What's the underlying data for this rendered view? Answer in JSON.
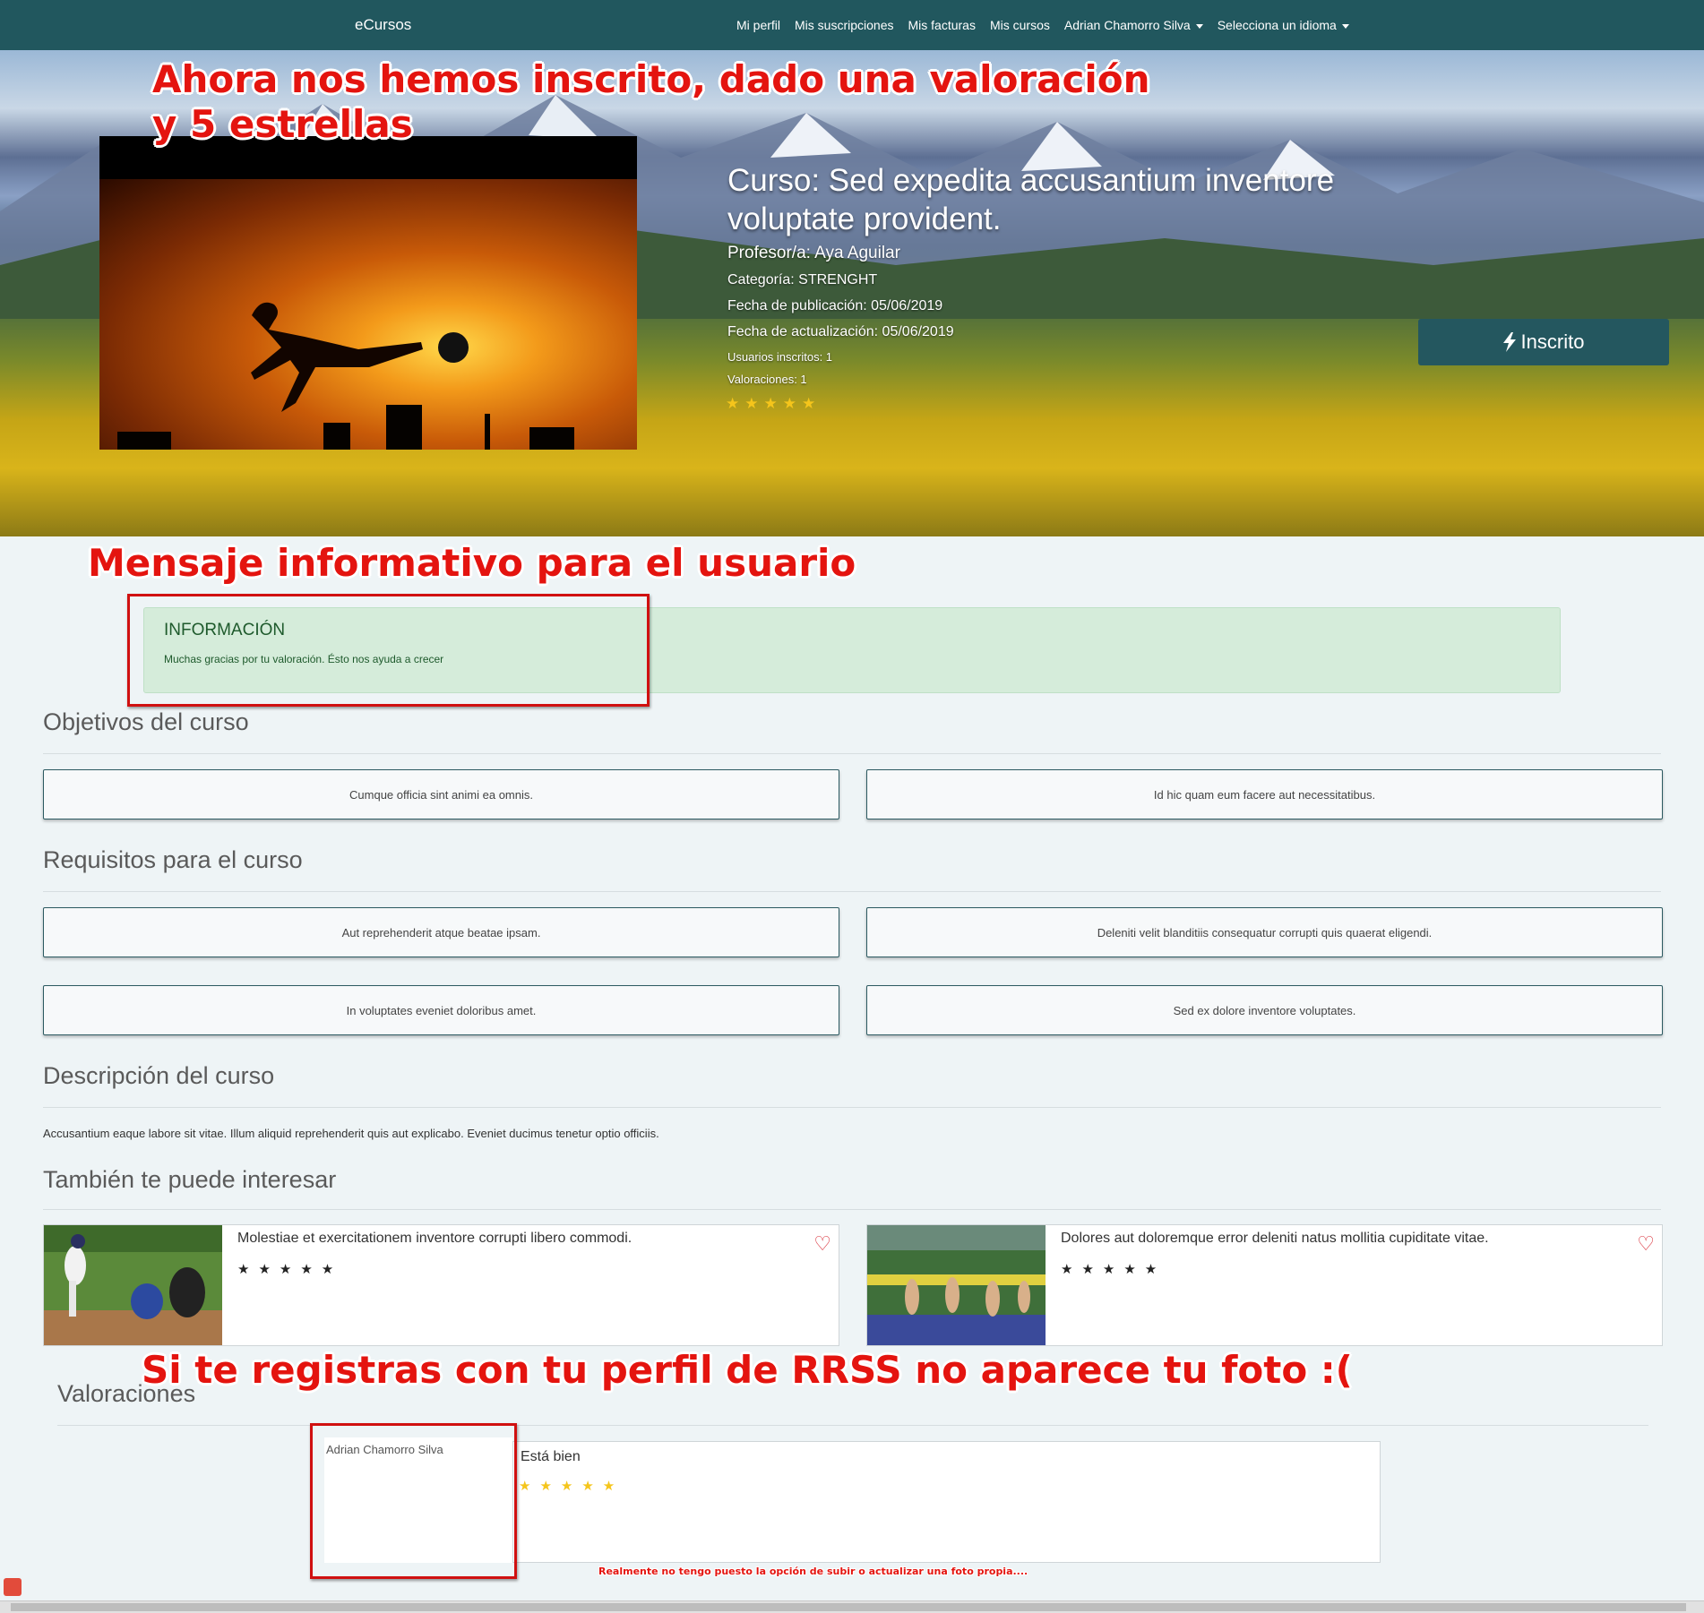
{
  "navbar": {
    "brand": "eCursos",
    "items": [
      "Mi perfil",
      "Mis suscripciones",
      "Mis facturas",
      "Mis cursos"
    ],
    "user": "Adrian Chamorro Silva",
    "language": "Selecciona un idioma"
  },
  "course": {
    "title": "Curso: Sed expedita accusantium inventore voluptate provident.",
    "teacher": "Profesor/a: Aya Aguilar",
    "category": "Categoría: STRENGHT",
    "published": "Fecha de publicación: 05/06/2019",
    "updated": "Fecha de actualización: 05/06/2019",
    "enrolled": "Usuarios inscritos: 1",
    "ratings": "Valoraciones: 1",
    "stars": "★★★★★",
    "enroll_button": "Inscrito",
    "enroll_icon": "bolt-icon"
  },
  "annotations": {
    "top_line1": "Ahora nos hemos inscrito, dado una valoración",
    "top_line2": "y 5 estrellas",
    "info": "Mensaje informativo para el usuario",
    "rrss": "Si te registras con tu perfil de RRSS no aparece tu foto :(",
    "footnote": "Realmente no tengo puesto la opción de subir o actualizar una foto propia....",
    "color": "#e4140f"
  },
  "alert": {
    "title": "INFORMACIÓN",
    "text": "Muchas gracias por tu valoración. Ésto nos ayuda a crecer"
  },
  "sections": {
    "objectives": {
      "title": "Objetivos del curso",
      "items": [
        "Cumque officia sint animi ea omnis.",
        "Id hic quam eum facere aut necessitatibus."
      ]
    },
    "requirements": {
      "title": "Requisitos para el curso",
      "items": [
        "Aut reprehenderit atque beatae ipsam.",
        "Deleniti velit blanditiis consequatur corrupti quis quaerat eligendi.",
        "In voluptates eveniet doloribus amet.",
        "Sed ex dolore inventore voluptates."
      ]
    },
    "description": {
      "title": "Descripción del curso",
      "text": "Accusantium eaque labore sit vitae. Illum aliquid reprehenderit quis aut explicabo. Eveniet ducimus tenetur optio officiis."
    },
    "related": {
      "title": "También te puede interesar",
      "cards": [
        {
          "title": "Molestiae et exercitationem inventore corrupti libero commodi.",
          "stars": "★★★★★",
          "heart": "♡"
        },
        {
          "title": "Dolores aut doloremque error deleniti natus mollitia cupiditate vitae.",
          "stars": "★★★★★",
          "heart": "♡"
        }
      ]
    },
    "reviews": {
      "title": "Valoraciones",
      "items": [
        {
          "user_alt": "Adrian Chamorro Silva",
          "text": "Está bien",
          "stars": "★★★★★"
        }
      ]
    }
  },
  "colors": {
    "navbar": "#21575e",
    "button": "#24575f",
    "star": "#f5c51b",
    "alert_bg": "#d5ecda"
  }
}
